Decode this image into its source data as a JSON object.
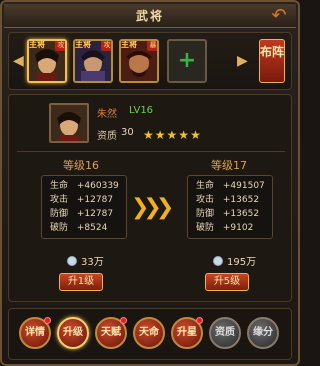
{
  "title": "武将",
  "hero_slots": [
    {
      "tag": "主将",
      "ribbon": "攻",
      "selected": true
    },
    {
      "tag": "主将",
      "ribbon": "攻",
      "selected": false
    },
    {
      "tag": "主将",
      "ribbon": "暴",
      "selected": false
    }
  ],
  "formation_label": "布阵",
  "hero": {
    "name": "朱然",
    "level": "LV16",
    "quality_label": "资质",
    "quality_value": "30",
    "stars": 5
  },
  "current": {
    "level_label": "等级16",
    "stats": [
      {
        "k": "生命",
        "v": "+460339"
      },
      {
        "k": "攻击",
        "v": "+12787"
      },
      {
        "k": "防御",
        "v": "+12787"
      },
      {
        "k": "破防",
        "v": "+8524"
      }
    ],
    "cost": "33万",
    "button": "升1级"
  },
  "next": {
    "level_label": "等级17",
    "stats": [
      {
        "k": "生命",
        "v": "+491507"
      },
      {
        "k": "攻击",
        "v": "+13652"
      },
      {
        "k": "防御",
        "v": "+13652"
      },
      {
        "k": "破防",
        "v": "+9102"
      }
    ],
    "cost": "195万",
    "button": "升5级"
  },
  "tabs": [
    {
      "label": "详情",
      "locked": false,
      "active": false,
      "dot": true
    },
    {
      "label": "升级",
      "locked": false,
      "active": true,
      "dot": false
    },
    {
      "label": "天赋",
      "locked": false,
      "active": false,
      "dot": true
    },
    {
      "label": "天命",
      "locked": false,
      "active": false,
      "dot": false
    },
    {
      "label": "升星",
      "locked": false,
      "active": false,
      "dot": true
    },
    {
      "label": "资质",
      "locked": true,
      "active": false,
      "dot": false
    },
    {
      "label": "缘分",
      "locked": true,
      "active": false,
      "dot": false
    }
  ]
}
